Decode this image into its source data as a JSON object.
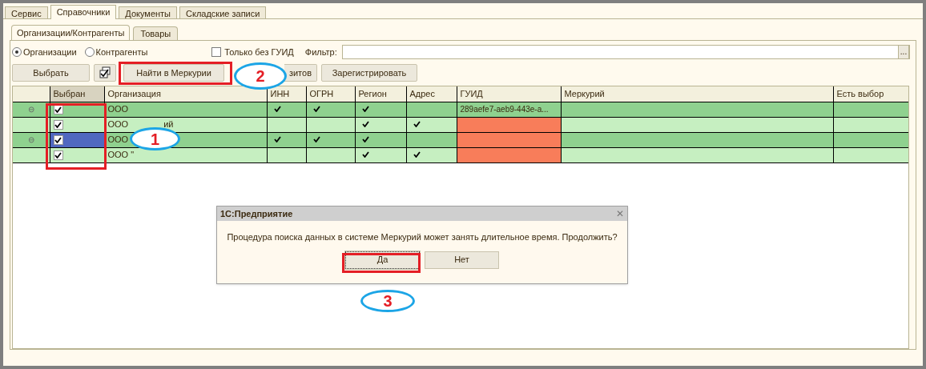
{
  "top_tabs": [
    {
      "label": "Сервис",
      "selected": false
    },
    {
      "label": "Справочники",
      "selected": true
    },
    {
      "label": "Документы",
      "selected": false
    },
    {
      "label": "Складские записи",
      "selected": false
    }
  ],
  "sub_tabs": [
    {
      "label": "Организации/Контрагенты",
      "selected": true
    },
    {
      "label": "Товары",
      "selected": false
    }
  ],
  "radios": [
    {
      "label": "Организации",
      "selected": true
    },
    {
      "label": "Контрагенты",
      "selected": false
    }
  ],
  "only_without_guid": {
    "label": "Только без ГУИД",
    "checked": false
  },
  "filter": {
    "label": "Фильтр:",
    "button": "..."
  },
  "toolbar": {
    "select": "Выбрать",
    "find": "Найти в Меркурии",
    "partial": "зитов",
    "register": "Зарегистрировать"
  },
  "table": {
    "columns": [
      "Выбран",
      "Организация",
      "ИНН",
      "ОГРН",
      "Регион",
      "Адрес",
      "ГУИД",
      "Меркурий",
      "Есть выбор"
    ],
    "rows": [
      {
        "kind": "group",
        "collapse": "⊖",
        "chosen": true,
        "selected": false,
        "org": [
          "ООО"
        ],
        "inn": true,
        "ogrn": true,
        "region": true,
        "address": false,
        "guid": "289aefe7-aeb9-443e-a...",
        "guid_missing": false
      },
      {
        "kind": "child",
        "chosen": true,
        "selected": false,
        "org": [
          "ООО",
          "ий"
        ],
        "inn": false,
        "ogrn": false,
        "region": true,
        "address": true,
        "guid_missing": true
      },
      {
        "kind": "group",
        "collapse": "⊖",
        "chosen": true,
        "selected": true,
        "org": [
          "ООО"
        ],
        "inn": true,
        "ogrn": true,
        "region": true,
        "address": false,
        "guid_missing": true
      },
      {
        "kind": "child",
        "chosen": true,
        "selected": false,
        "org": [
          "ООО \""
        ],
        "inn": false,
        "ogrn": false,
        "region": true,
        "address": true,
        "guid_missing": true
      }
    ]
  },
  "dialog": {
    "title": "1С:Предприятие",
    "close": "✕",
    "message": "Процедура поиска данных в системе Меркурий может занять длительное время. Продолжить?",
    "buttons": [
      {
        "label": "Да",
        "selected": true
      },
      {
        "label": "Нет",
        "selected": false
      }
    ]
  },
  "annotations": [
    "1",
    "2",
    "3"
  ]
}
